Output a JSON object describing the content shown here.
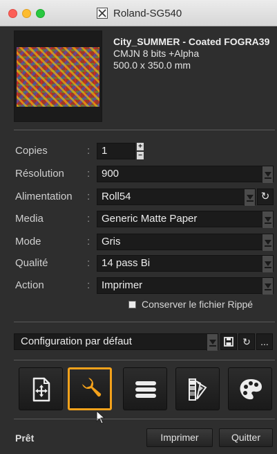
{
  "window": {
    "title": "Roland-SG540"
  },
  "image": {
    "name": "City_SUMMER - Coated FOGRA39",
    "color_mode": "CMJN 8 bits +Alpha",
    "size": "500.0 x 350.0 mm"
  },
  "settings": {
    "colon": ":",
    "copies": {
      "label": "Copies",
      "value": "1"
    },
    "resolution": {
      "label": "Résolution",
      "value": "900"
    },
    "feed": {
      "label": "Alimentation",
      "value": "Roll54"
    },
    "media": {
      "label": "Media",
      "value": "Generic Matte Paper"
    },
    "mode": {
      "label": "Mode",
      "value": "Gris"
    },
    "quality": {
      "label": "Qualité",
      "value": "14 pass Bi"
    },
    "action": {
      "label": "Action",
      "value": "Imprimer"
    },
    "keep_ripped": {
      "label": "Conserver le fichier Rippé",
      "checked": false
    }
  },
  "config": {
    "value": "Configuration par défaut",
    "more_label": "..."
  },
  "icons": {
    "refresh": "refresh-icon",
    "save": "save-icon",
    "tools": [
      "place-icon",
      "wrench-icon",
      "list-icon",
      "swatches-icon",
      "palette-icon"
    ]
  },
  "colors": {
    "accent": "#f4a21b",
    "panel": "#2e2e2e",
    "field": "#1b1b1b"
  },
  "footer": {
    "status": "Prêt",
    "print_label": "Imprimer",
    "quit_label": "Quitter"
  }
}
